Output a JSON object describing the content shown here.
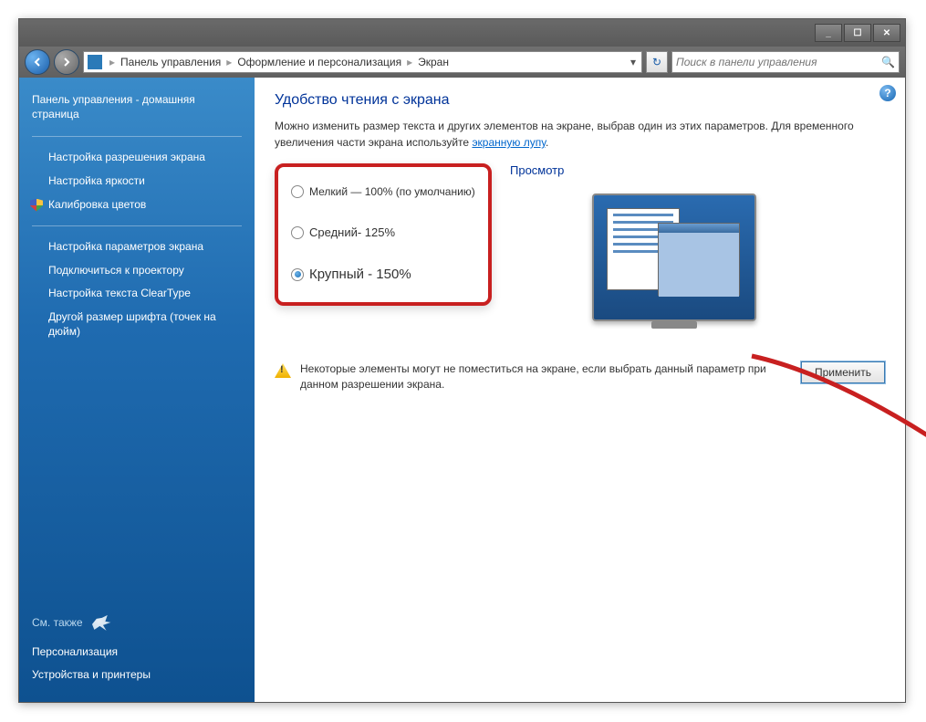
{
  "titlebar": {
    "min": "_",
    "max": "☐",
    "close": "✕"
  },
  "nav": {
    "crumbs": [
      "Панель управления",
      "Оформление и персонализация",
      "Экран"
    ],
    "search_placeholder": "Поиск в панели управления"
  },
  "sidebar": {
    "home": "Панель управления - домашняя страница",
    "tasks": [
      "Настройка разрешения экрана",
      "Настройка яркости",
      "Калибровка цветов",
      "Настройка параметров экрана",
      "Подключиться к проектору",
      "Настройка текста ClearType",
      "Другой размер шрифта (точек на дюйм)"
    ],
    "see_also_label": "См. также",
    "see_also": [
      "Персонализация",
      "Устройства и принтеры"
    ]
  },
  "main": {
    "title": "Удобство чтения с экрана",
    "desc_pre": "Можно изменить размер текста и других элементов на экране, выбрав один из этих параметров. Для временного увеличения части экрана используйте ",
    "desc_link": "экранную лупу",
    "desc_post": ".",
    "options": {
      "small": "Мелкий — 100% (по умолчанию)",
      "medium": "Средний- 125%",
      "large": "Крупный - 150%"
    },
    "preview_label": "Просмотр",
    "warning": "Некоторые элементы могут не поместиться на экране, если выбрать данный параметр при данном разрешении экрана.",
    "apply": "Применить"
  }
}
